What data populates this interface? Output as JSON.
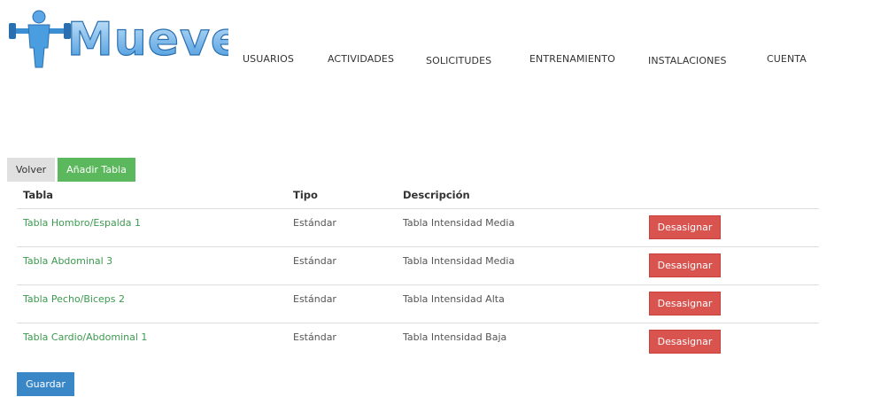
{
  "brand": {
    "logo_text": "MueveT"
  },
  "nav": {
    "items": [
      {
        "label": "USUARIOS"
      },
      {
        "label": "ACTIVIDADES"
      },
      {
        "label": "SOLICITUDES"
      },
      {
        "label": "ENTRENAMIENTO"
      },
      {
        "label": "INSTALACIONES"
      },
      {
        "label": "CUENTA"
      }
    ]
  },
  "actions": {
    "volver_label": "Volver",
    "add_label": "Añadir Tabla",
    "guardar_label": "Guardar"
  },
  "table": {
    "headers": [
      "Tabla",
      "Tipo",
      "Descripción"
    ],
    "rows": [
      {
        "name": "Tabla Hombro/Espalda 1",
        "tipo": "Estándar",
        "descripcion": "Tabla Intensidad Media",
        "action": "Desasignar"
      },
      {
        "name": "Tabla Abdominal 3",
        "tipo": "Estándar",
        "descripcion": "Tabla Intensidad Media",
        "action": "Desasignar"
      },
      {
        "name": "Tabla Pecho/Biceps 2",
        "tipo": "Estándar",
        "descripcion": "Tabla Intensidad Alta",
        "action": "Desasignar"
      },
      {
        "name": "Tabla Cardio/Abdominal 1",
        "tipo": "Estándar",
        "descripcion": "Tabla Intensidad Baja",
        "action": "Desasignar"
      }
    ]
  },
  "colors": {
    "link_green": "#3c9a4f",
    "add_button": "#5cb85c",
    "danger_button": "#d9534f",
    "primary_button": "#3a87c8",
    "logo_blue": "#4a9ee0"
  }
}
